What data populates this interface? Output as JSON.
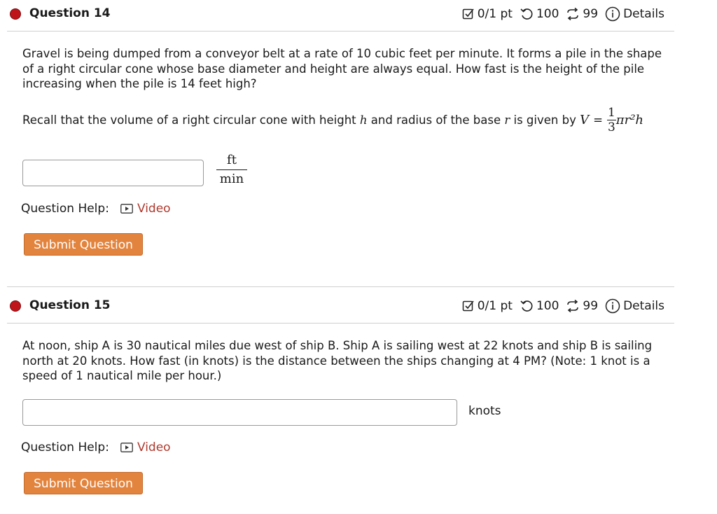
{
  "questions": [
    {
      "title": "Question 14",
      "status_color": "#c0141b",
      "points": "0/1 pt",
      "retries": "100",
      "submissions": "99",
      "details_label": "Details",
      "text": "Gravel is being dumped from a conveyor belt at a rate of 10 cubic feet per minute. It forms a pile in the shape of a right circular cone whose base diameter and height are always equal. How fast is the height of the pile increasing when the pile is 14 feet high?",
      "recall_prefix": "Recall that the volume of a right circular cone with height ",
      "recall_h": "h",
      "recall_mid": " and radius of the base ",
      "recall_r": "r",
      "recall_suffix": " is given by ",
      "formula": {
        "lhs": "V",
        "equals": "=",
        "frac_num": "1",
        "frac_den": "3",
        "rest": "πr²h"
      },
      "answer_value": "",
      "unit_num": "ft",
      "unit_den": "min",
      "help_label": "Question Help:",
      "video_label": "Video",
      "submit_label": "Submit Question"
    },
    {
      "title": "Question 15",
      "status_color": "#c0141b",
      "points": "0/1 pt",
      "retries": "100",
      "submissions": "99",
      "details_label": "Details",
      "text": "At noon, ship A is 30 nautical miles due west of ship B. Ship A is sailing west at 22 knots and ship B is sailing north at 20 knots. How fast (in knots) is the distance between the ships changing at 4 PM? (Note: 1 knot is a speed of 1 nautical mile per hour.)",
      "answer_value": "",
      "unit": "knots",
      "help_label": "Question Help:",
      "video_label": "Video",
      "submit_label": "Submit Question"
    }
  ],
  "icons": {
    "points": "checkbox-pencil-icon",
    "retries": "undo-icon",
    "submissions": "repeat-icon",
    "details": "info-icon",
    "video": "play-box-icon"
  }
}
